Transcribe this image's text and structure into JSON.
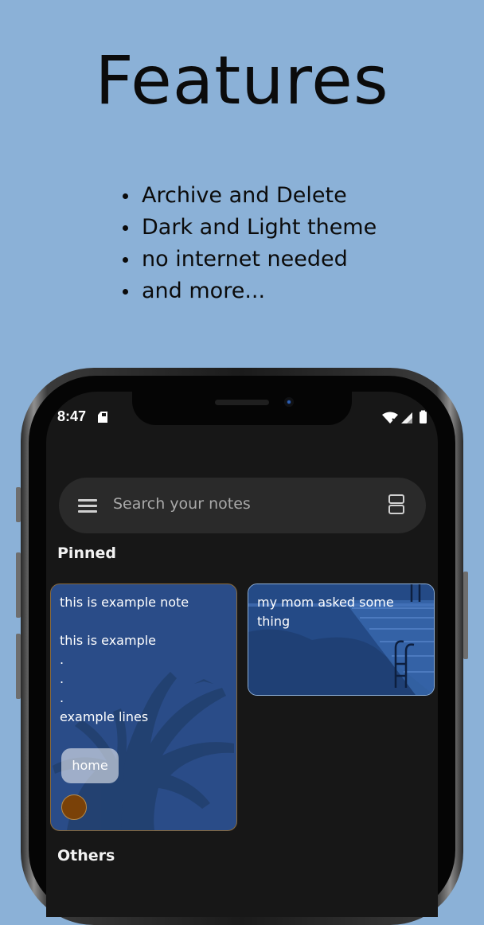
{
  "headline": "Features",
  "features": [
    "Archive and Delete",
    "Dark and Light theme",
    "no internet needed",
    "and more..."
  ],
  "status_bar": {
    "time": "8:47",
    "icons": [
      "sd-card-icon",
      "wifi-icon",
      "signal-icon",
      "battery-icon"
    ]
  },
  "search": {
    "placeholder": "Search your notes",
    "icons": [
      "menu-icon",
      "layout-toggle-icon"
    ]
  },
  "sections": {
    "pinned": "Pinned",
    "others": "Others"
  },
  "notes": [
    {
      "text": "this is example note\n\nthis is example\n.\n.\n.\nexample lines",
      "label": "home",
      "color": "#7a4108",
      "background": "#2a4c88"
    },
    {
      "text": "my mom asked some\nthing",
      "background": "#244a86"
    }
  ],
  "colors": {
    "page_background": "#8bb1d7",
    "app_background": "#171717",
    "search_bar": "#2a2a2a"
  }
}
